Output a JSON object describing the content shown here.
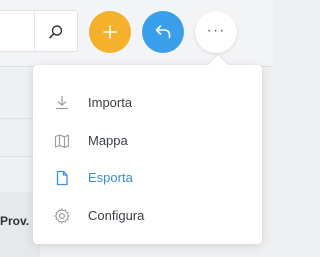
{
  "toolbar": {
    "search_icon": "search-icon",
    "add_button_icon": "plus-icon",
    "share_button_icon": "reply-icon",
    "more_button_label": "···",
    "colors": {
      "add": "#f5b02c",
      "share": "#3a9fea",
      "more": "#ffffff"
    }
  },
  "table": {
    "column_header": "Prov."
  },
  "menu": {
    "items": [
      {
        "label": "Importa",
        "icon": "download-icon",
        "active": false
      },
      {
        "label": "Mappa",
        "icon": "map-icon",
        "active": false
      },
      {
        "label": "Esporta",
        "icon": "file-icon",
        "active": true
      },
      {
        "label": "Configura",
        "icon": "gear-icon",
        "active": false
      }
    ],
    "active_color": "#3a8fdc"
  }
}
